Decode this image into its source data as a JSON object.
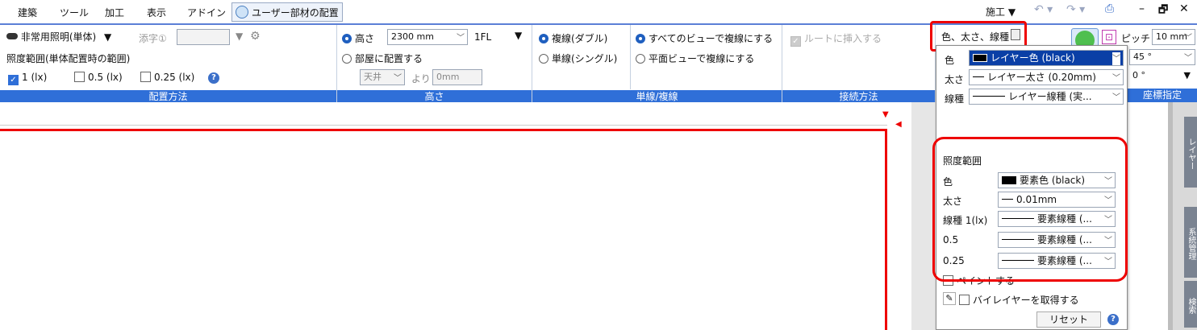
{
  "menubar": {
    "items": [
      "建築",
      "ツール",
      "加工",
      "表示",
      "アドイン"
    ],
    "active_tab": "ユーザー部材の配置",
    "right_label": "施工"
  },
  "ribbon": {
    "placement": {
      "fixture_select": "非常用照明(単体)",
      "suffix_label": "添字①",
      "range_label": "照度範囲(単体配置時の範囲)",
      "checks": [
        {
          "label": "1 (lx)",
          "checked": true
        },
        {
          "label": "0.5 (lx)",
          "checked": false
        },
        {
          "label": "0.25 (lx)",
          "checked": false
        }
      ],
      "footer": "配置方法"
    },
    "height": {
      "height_label": "高さ",
      "height_value": "2300 mm",
      "floor_value": "1FL",
      "room_label": "部屋に配置する",
      "ceiling_value": "天井",
      "from_label": "より",
      "offset_value": "0mm",
      "footer": "高さ"
    },
    "line": {
      "double_label": "複線(ダブル)",
      "single_label": "単線(シングル)",
      "all_views_label": "すべてのビューで複線にする",
      "plan_view_label": "平面ビューで複線にする",
      "footer": "単線/複線"
    },
    "connect": {
      "insert_route_label": "ルートに挿入する",
      "footer": "接続方法"
    },
    "coords": {
      "pitch_label": "ピッチ",
      "pitch_value": "10 mm",
      "angle1": "45 °",
      "angle2": "0 °",
      "footer": "座標指定"
    }
  },
  "panel": {
    "header_button": "色、太さ、線種",
    "rows": [
      {
        "label": "色",
        "value": "レイヤー色 (black)"
      },
      {
        "label": "太さ",
        "value": "レイヤー太さ (0.20mm)"
      },
      {
        "label": "線種",
        "value": "レイヤー線種 (実..."
      }
    ],
    "section_title": "照度範囲",
    "range_rows": [
      {
        "label": "色",
        "value": "要素色 (black)"
      },
      {
        "label": "太さ",
        "value": "0.01mm"
      },
      {
        "label": "線種 1(lx)",
        "value": "要素線種 (..."
      },
      {
        "label": "0.5",
        "value": "要素線種 (..."
      },
      {
        "label": "0.25",
        "value": "要素線種 (..."
      }
    ],
    "paint_label": "ペイントする",
    "bylayer_label": "バイレイヤーを取得する",
    "reset_label": "リセット"
  },
  "sidebar": {
    "tabs": [
      "レイヤー",
      "系統管理",
      "検索"
    ]
  },
  "colors": {
    "accent": "#2f6fd8",
    "highlight": "#e00000"
  }
}
